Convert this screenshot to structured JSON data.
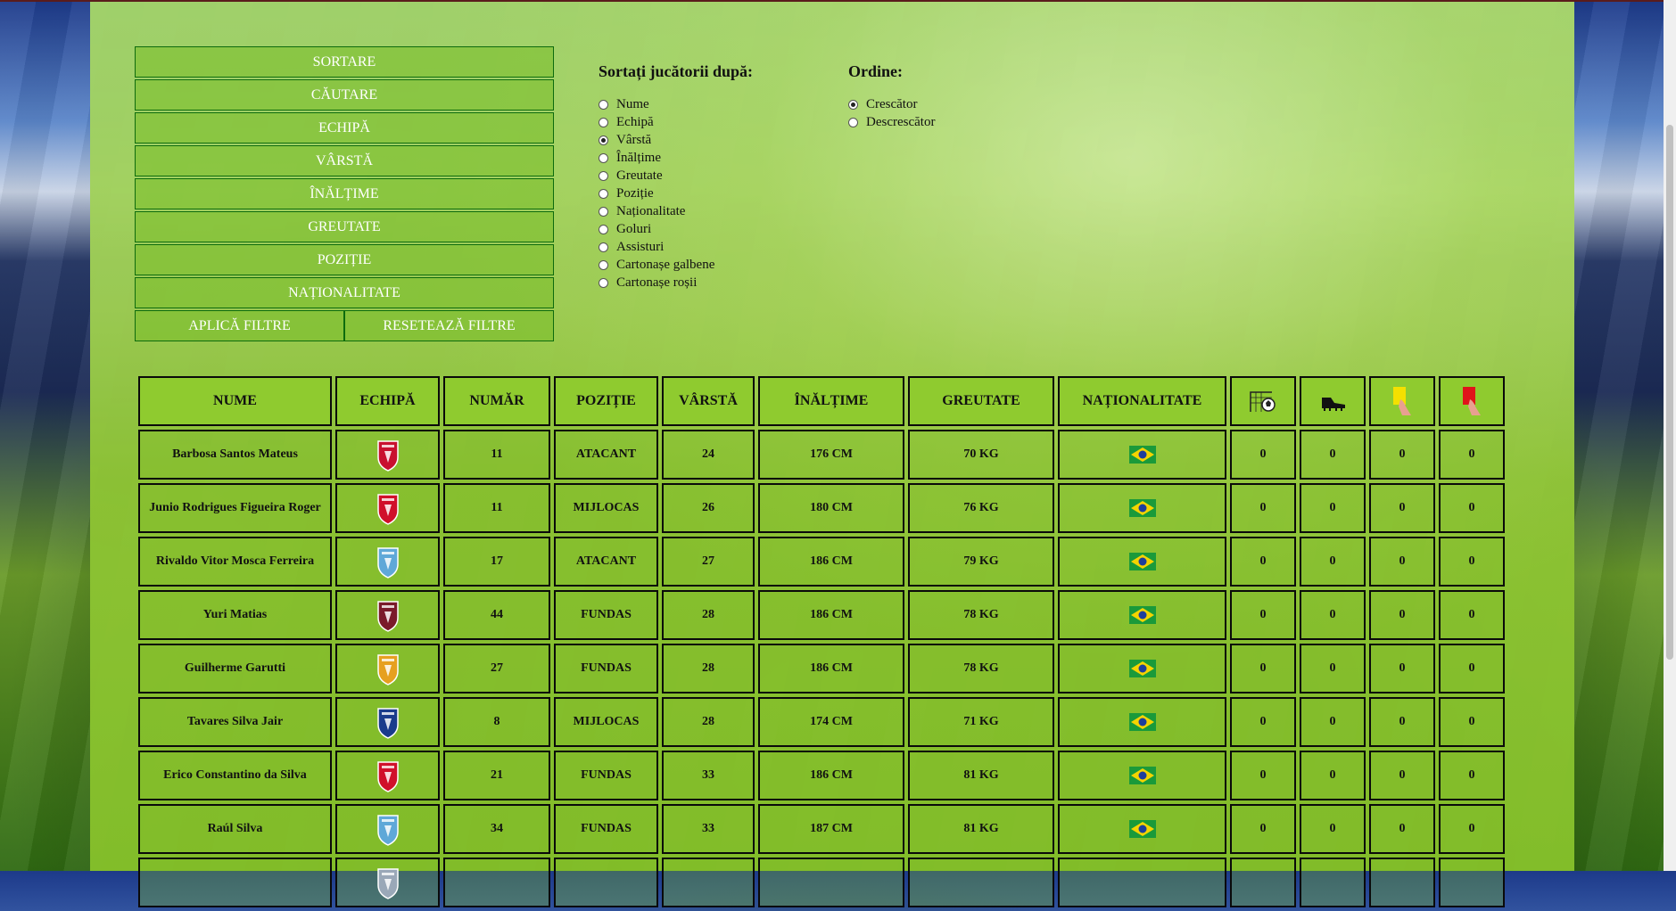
{
  "menu": {
    "sort": "SORTARE",
    "search": "CĂUTARE",
    "team": "ECHIPĂ",
    "age": "VÂRSTĂ",
    "height": "ÎNĂLȚIME",
    "weight": "GREUTATE",
    "position": "POZIȚIE",
    "nationality": "NAȚIONALITATE",
    "apply": "APLICĂ FILTRE",
    "reset": "RESETEAZĂ FILTRE"
  },
  "sort_panel": {
    "title": "Sortați jucătorii după:",
    "selected": "Vârstă",
    "options": [
      "Nume",
      "Echipă",
      "Vârstă",
      "Înălțime",
      "Greutate",
      "Poziție",
      "Naționalitate",
      "Goluri",
      "Assisturi",
      "Cartonașe galbene",
      "Cartonașe roșii"
    ]
  },
  "order_panel": {
    "title": "Ordine:",
    "selected": "Crescător",
    "options": [
      "Crescător",
      "Descrescător"
    ]
  },
  "table": {
    "headers": {
      "name": "NUME",
      "team": "ECHIPĂ",
      "number": "NUMĂR",
      "position": "POZIȚIE",
      "age": "VÂRSTĂ",
      "height": "ÎNĂLȚIME",
      "weight": "GREUTATE",
      "nationality": "NAȚIONALITATE",
      "goals_icon": "ball-net-icon",
      "assists_icon": "boot-icon",
      "yellow_icon": "yellow-card-icon",
      "red_icon": "red-card-icon"
    },
    "rows": [
      {
        "name": "Barbosa Santos Mateus",
        "crest": "crest-icon",
        "crest_color": "#c8102e",
        "number": "11",
        "position": "ATACANT",
        "age": "24",
        "height": "176 CM",
        "weight": "70 KG",
        "flag": "brazil-flag-icon",
        "goals": "0",
        "assists": "0",
        "yellow": "0",
        "red": "0"
      },
      {
        "name": "Junio Rodrigues Figueira Roger",
        "crest": "crest-icon",
        "crest_color": "#d0102a",
        "number": "11",
        "position": "MIJLOCAS",
        "age": "26",
        "height": "180 CM",
        "weight": "76 KG",
        "flag": "brazil-flag-icon",
        "goals": "0",
        "assists": "0",
        "yellow": "0",
        "red": "0"
      },
      {
        "name": "Rivaldo Vitor Mosca Ferreira",
        "crest": "crest-icon",
        "crest_color": "#5fa8d8",
        "number": "17",
        "position": "ATACANT",
        "age": "27",
        "height": "186 CM",
        "weight": "79 KG",
        "flag": "brazil-flag-icon",
        "goals": "0",
        "assists": "0",
        "yellow": "0",
        "red": "0"
      },
      {
        "name": "Yuri Matias",
        "crest": "crest-icon",
        "crest_color": "#7a1a2a",
        "number": "44",
        "position": "FUNDAS",
        "age": "28",
        "height": "186 CM",
        "weight": "78 KG",
        "flag": "brazil-flag-icon",
        "goals": "0",
        "assists": "0",
        "yellow": "0",
        "red": "0"
      },
      {
        "name": "Guilherme Garutti",
        "crest": "crest-icon",
        "crest_color": "#e6a020",
        "number": "27",
        "position": "FUNDAS",
        "age": "28",
        "height": "186 CM",
        "weight": "78 KG",
        "flag": "brazil-flag-icon",
        "goals": "0",
        "assists": "0",
        "yellow": "0",
        "red": "0"
      },
      {
        "name": "Tavares Silva Jair",
        "crest": "crest-icon",
        "crest_color": "#1a3c8c",
        "number": "8",
        "position": "MIJLOCAS",
        "age": "28",
        "height": "174 CM",
        "weight": "71 KG",
        "flag": "brazil-flag-icon",
        "goals": "0",
        "assists": "0",
        "yellow": "0",
        "red": "0"
      },
      {
        "name": "Erico Constantino da Silva",
        "crest": "crest-icon",
        "crest_color": "#d0102a",
        "number": "21",
        "position": "FUNDAS",
        "age": "33",
        "height": "186 CM",
        "weight": "81 KG",
        "flag": "brazil-flag-icon",
        "goals": "0",
        "assists": "0",
        "yellow": "0",
        "red": "0"
      },
      {
        "name": "Raúl Silva",
        "crest": "crest-icon",
        "crest_color": "#5fa8d8",
        "number": "34",
        "position": "FUNDAS",
        "age": "33",
        "height": "187 CM",
        "weight": "81 KG",
        "flag": "brazil-flag-icon",
        "goals": "0",
        "assists": "0",
        "yellow": "0",
        "red": "0"
      },
      {
        "name": "",
        "crest": "crest-icon",
        "crest_color": "#9aa8b8",
        "number": "",
        "position": "",
        "age": "",
        "height": "",
        "weight": "",
        "flag": "",
        "goals": "",
        "assists": "",
        "yellow": "",
        "red": ""
      }
    ]
  }
}
